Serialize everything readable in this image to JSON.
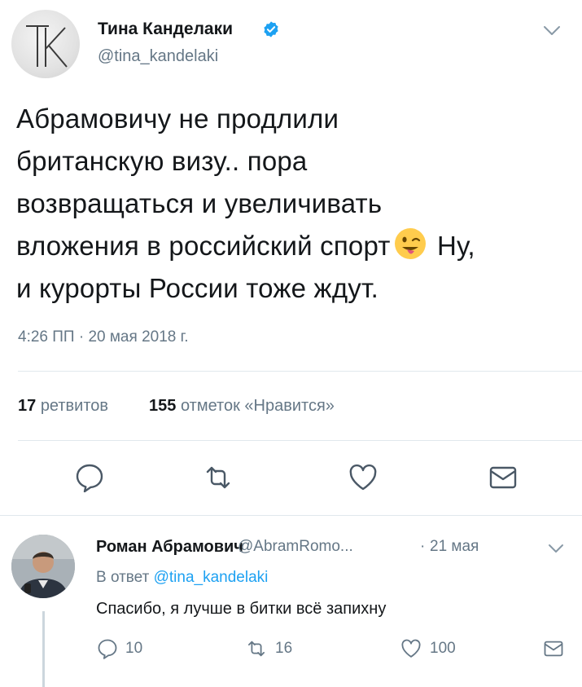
{
  "tweet": {
    "author": {
      "name": "Тина Канделаки",
      "handle": "@tina_kandelaki",
      "avatar_monogram": "TK",
      "verified_icon": "verified-badge-icon"
    },
    "text_lines": [
      "Абрамовичу не продлили",
      "британскую визу.. пора",
      "возвращаться и увеличивать"
    ],
    "text_line4_before": "вложения в российский спорт",
    "text_line4_after": " Ну,",
    "text_line5": "и курорты России тоже ждут.",
    "emoji_icon": "winking-face-with-tongue-icon",
    "timestamp": "4:26 ПП · 20 мая 2018 г.",
    "stats": {
      "retweets_count": "17",
      "retweets_label": "ретвитов",
      "likes_count": "155",
      "likes_label": "отметок «Нравится»"
    },
    "actions": [
      "reply-icon",
      "retweet-icon",
      "like-icon",
      "direct-message-icon"
    ]
  },
  "reply": {
    "name": "Роман Абрамович",
    "handle": "@AbramRomo...",
    "separator": "·",
    "date": "21 мая",
    "in_reply_prefix": "В ответ ",
    "in_reply_mention": "@tina_kandelaki",
    "text": "Спасибо, я лучше в битки всё запихну",
    "replies_count": "10",
    "retweets_count": "16",
    "likes_count": "100"
  },
  "colors": {
    "accent": "#1da1f2",
    "secondary_text": "#657786",
    "primary_text": "#14171a",
    "divider": "#e1e8ed"
  }
}
